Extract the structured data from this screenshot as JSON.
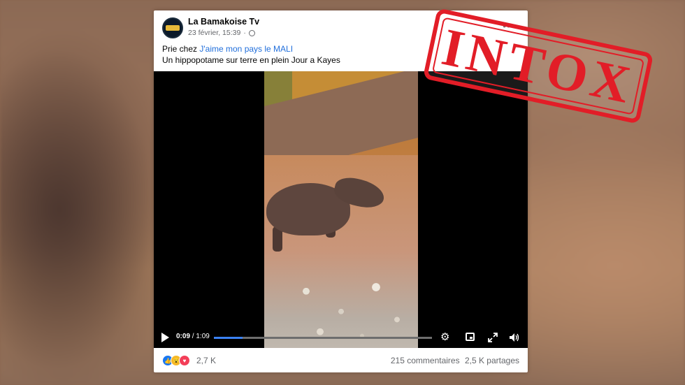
{
  "post": {
    "page_name": "La Bamakoise Tv",
    "date": "23 février, 15:39",
    "intro": "Prie chez",
    "linked_page": "J'aime mon pays le MALI",
    "caption": "Un hippopotame sur terre en plein Jour a Kayes"
  },
  "video": {
    "current_time": "0:09",
    "separator": " / ",
    "duration": "1:09",
    "progress": 0.13
  },
  "footer": {
    "reaction_count": "2,7 K",
    "comments": "215 commentaires",
    "shares": "2,5 K partages",
    "reactions": [
      "like-icon",
      "wow-icon",
      "love-icon"
    ]
  },
  "stamp": {
    "label": "INTOX",
    "color": "#e21d27"
  },
  "colors": {
    "link": "#216fdb",
    "progress": "#3b82f6"
  }
}
